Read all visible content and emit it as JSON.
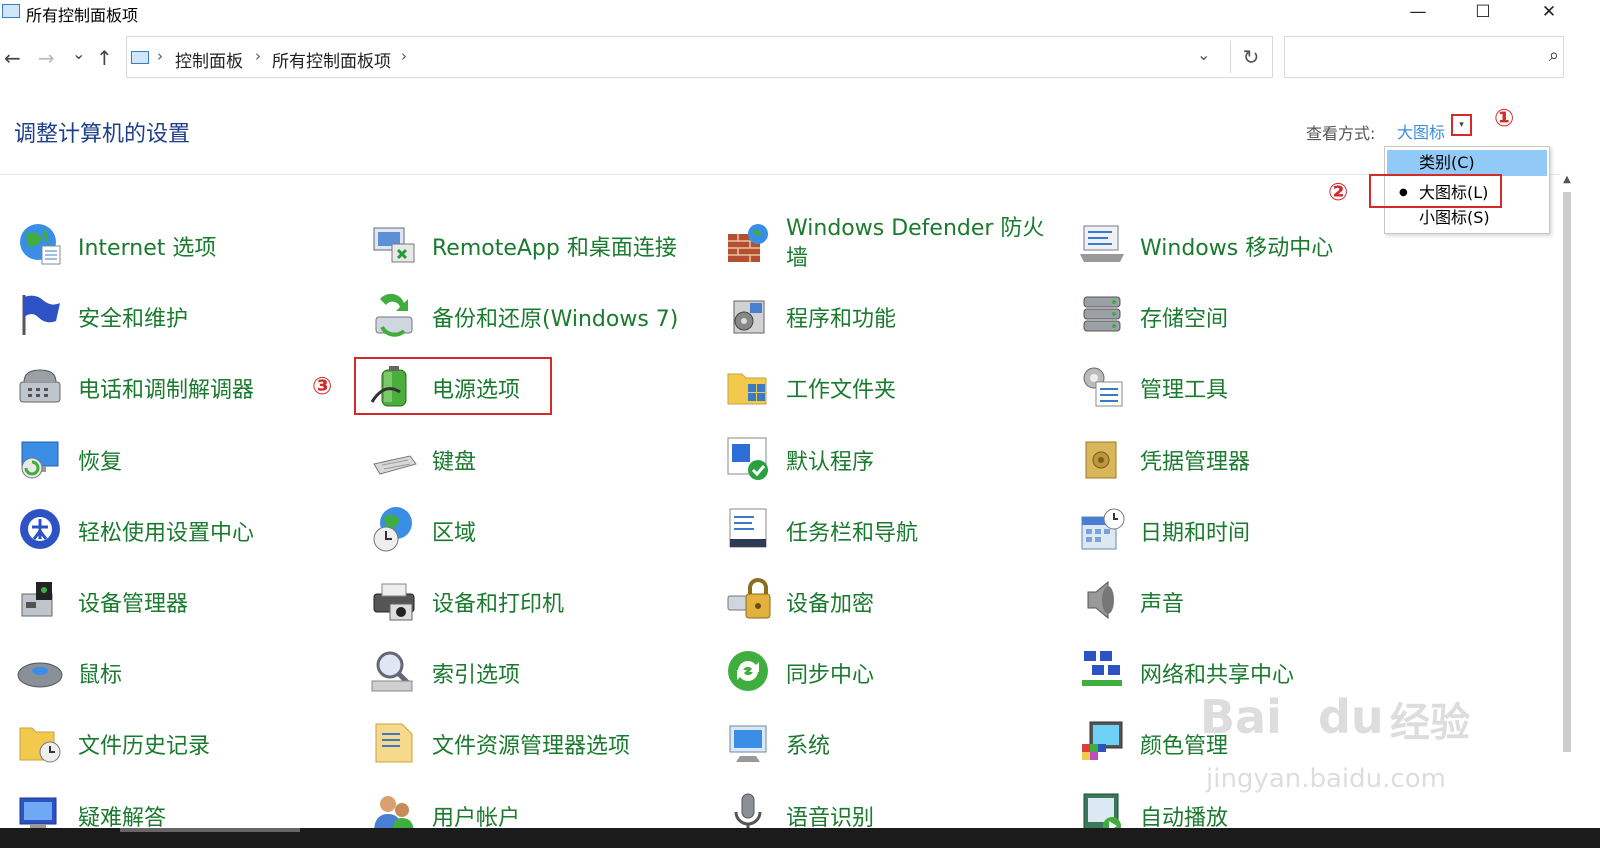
{
  "window": {
    "title": "所有控制面板项",
    "controls": [
      "—",
      "☐",
      "✕"
    ]
  },
  "nav": {
    "back": "←",
    "forward": "→",
    "recent": "⌄",
    "up": "↑"
  },
  "address": {
    "crumbs": [
      "控制面板",
      "所有控制面板项"
    ],
    "separator": "›",
    "dropdown": "⌄",
    "refresh": "↻"
  },
  "search": {
    "placeholder": "",
    "icon": "⌕"
  },
  "header": {
    "title": "调整计算机的设置",
    "view_label": "查看方式:",
    "view_value": "大图标",
    "view_arrow": "▾"
  },
  "view_menu": {
    "items": [
      "类别(C)",
      "大图标(L)",
      "小图标(S)"
    ],
    "selected_index": 1,
    "bullet": "●"
  },
  "markers": [
    "①",
    "②",
    "③"
  ],
  "items": [
    {
      "label": "Internet 选项",
      "icon": "globe-icon"
    },
    {
      "label": "RemoteApp 和桌面连接",
      "icon": "remoteapp-icon"
    },
    {
      "label": "Windows Defender 防火墙",
      "icon": "firewall-icon"
    },
    {
      "label": "Windows 移动中心",
      "icon": "mobility-center-icon"
    },
    {
      "label": "安全和维护",
      "icon": "flag-icon"
    },
    {
      "label": "备份和还原(Windows 7)",
      "icon": "backup-icon"
    },
    {
      "label": "程序和功能",
      "icon": "programs-icon"
    },
    {
      "label": "存储空间",
      "icon": "storage-icon"
    },
    {
      "label": "电话和调制解调器",
      "icon": "phone-icon"
    },
    {
      "label": "电源选项",
      "icon": "battery-icon"
    },
    {
      "label": "工作文件夹",
      "icon": "work-folders-icon"
    },
    {
      "label": "管理工具",
      "icon": "admin-tools-icon"
    },
    {
      "label": "恢复",
      "icon": "recovery-icon"
    },
    {
      "label": "键盘",
      "icon": "keyboard-icon"
    },
    {
      "label": "默认程序",
      "icon": "default-programs-icon"
    },
    {
      "label": "凭据管理器",
      "icon": "credential-icon"
    },
    {
      "label": "轻松使用设置中心",
      "icon": "ease-of-access-icon"
    },
    {
      "label": "区域",
      "icon": "region-icon"
    },
    {
      "label": "任务栏和导航",
      "icon": "taskbar-icon"
    },
    {
      "label": "日期和时间",
      "icon": "calendar-icon"
    },
    {
      "label": "设备管理器",
      "icon": "device-manager-icon"
    },
    {
      "label": "设备和打印机",
      "icon": "printer-icon"
    },
    {
      "label": "设备加密",
      "icon": "encryption-icon"
    },
    {
      "label": "声音",
      "icon": "speaker-icon"
    },
    {
      "label": "鼠标",
      "icon": "mouse-icon"
    },
    {
      "label": "索引选项",
      "icon": "indexing-icon"
    },
    {
      "label": "同步中心",
      "icon": "sync-icon"
    },
    {
      "label": "网络和共享中心",
      "icon": "network-icon"
    },
    {
      "label": "文件历史记录",
      "icon": "file-history-icon"
    },
    {
      "label": "文件资源管理器选项",
      "icon": "folder-options-icon"
    },
    {
      "label": "系统",
      "icon": "system-icon"
    },
    {
      "label": "颜色管理",
      "icon": "color-management-icon"
    },
    {
      "label": "疑难解答",
      "icon": "troubleshoot-icon"
    },
    {
      "label": "用户帐户",
      "icon": "users-icon"
    },
    {
      "label": "语音识别",
      "icon": "microphone-icon"
    },
    {
      "label": "自动播放",
      "icon": "autoplay-icon"
    }
  ],
  "watermark": {
    "brand": "Bai",
    "brand2": "du",
    "cn": "经验",
    "url": "jingyan.baidu.com"
  },
  "colors": {
    "link_green": "#1a7a2e",
    "heading_blue": "#1e3f8a",
    "annotation_red": "#d32b2b",
    "menu_highlight": "#91c9f7"
  }
}
